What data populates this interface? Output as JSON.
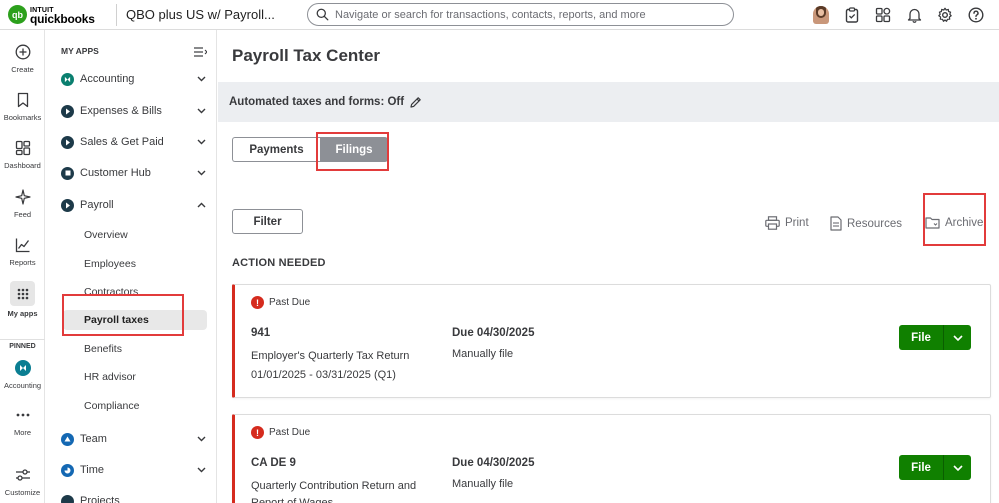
{
  "topbar": {
    "brand_line1": "INTUIT",
    "brand_line2": "quickbooks",
    "company": "QBO plus US w/ Payroll...",
    "search_placeholder": "Navigate or search for transactions, contacts, reports, and more"
  },
  "rail": {
    "items": [
      {
        "label": "Create",
        "icon": "plus-circle-icon"
      },
      {
        "label": "Bookmarks",
        "icon": "bookmark-icon"
      },
      {
        "label": "Dashboard",
        "icon": "dashboard-icon"
      },
      {
        "label": "Feed",
        "icon": "sparkle-icon"
      },
      {
        "label": "Reports",
        "icon": "chart-line-icon"
      },
      {
        "label": "My apps",
        "icon": "grid-icon"
      }
    ],
    "pinned_label": "PINNED",
    "pinned_item": "Accounting",
    "more_label": "More",
    "customize_label": "Customize"
  },
  "sidebar": {
    "heading": "MY APPS",
    "items": [
      {
        "label": "Accounting"
      },
      {
        "label": "Expenses & Bills"
      },
      {
        "label": "Sales & Get Paid"
      },
      {
        "label": "Customer Hub"
      },
      {
        "label": "Payroll"
      }
    ],
    "payroll_sub": [
      "Overview",
      "Employees",
      "Contractors",
      "Payroll taxes",
      "Benefits",
      "HR advisor",
      "Compliance"
    ],
    "bottom_items": [
      {
        "label": "Team"
      },
      {
        "label": "Time"
      },
      {
        "label": "Projects"
      }
    ]
  },
  "main": {
    "title": "Payroll Tax Center",
    "banner": "Automated taxes and forms: Off",
    "tabs": [
      "Payments",
      "Filings"
    ],
    "filter_label": "Filter",
    "actions": {
      "print": "Print",
      "resources": "Resources",
      "archive": "Archive"
    },
    "section": "ACTION NEEDED",
    "cards": [
      {
        "status": "Past Due",
        "form": "941",
        "description": "Employer's Quarterly Tax Return",
        "period": "01/01/2025 - 03/31/2025 (Q1)",
        "due": "Due 04/30/2025",
        "method": "Manually file",
        "button": "File"
      },
      {
        "status": "Past Due",
        "form": "CA DE 9",
        "description": "Quarterly Contribution Return and Report of Wages",
        "period": "",
        "due": "Due 04/30/2025",
        "method": "Manually file",
        "button": "File"
      }
    ]
  },
  "colors": {
    "brand_green": "#2ca01c",
    "file_green": "#108000",
    "past_due_red": "#d52b1e",
    "highlight_red": "#e23b3b"
  }
}
